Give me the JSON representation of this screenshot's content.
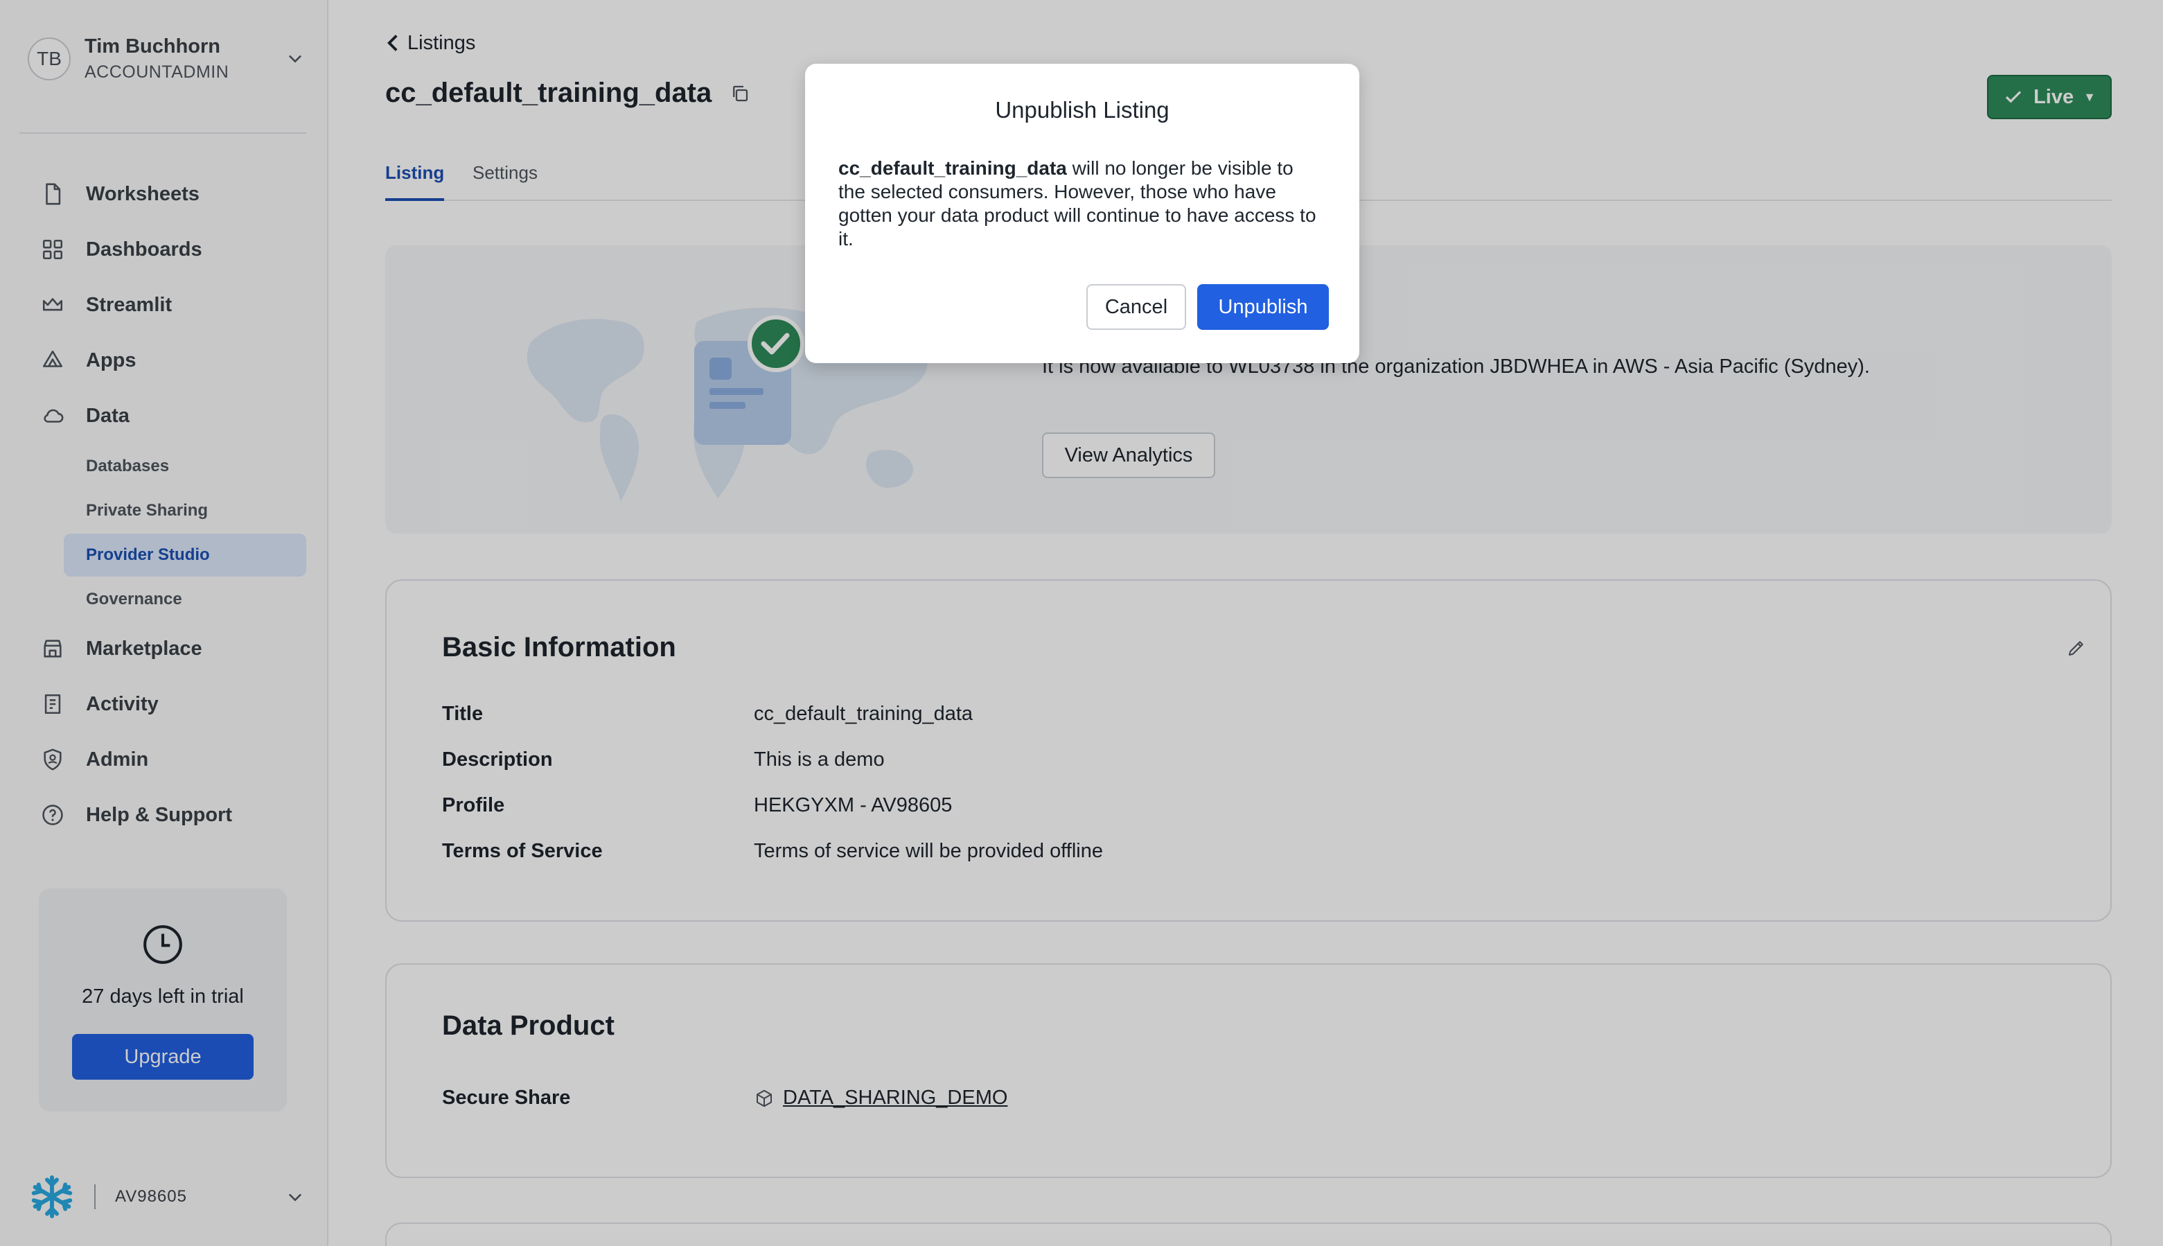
{
  "sidebar": {
    "user": {
      "initials": "TB",
      "name": "Tim Buchhorn",
      "role": "ACCOUNTADMIN"
    },
    "nav": {
      "worksheets": "Worksheets",
      "dashboards": "Dashboards",
      "streamlit": "Streamlit",
      "apps": "Apps",
      "data": "Data",
      "databases": "Databases",
      "private_sharing": "Private Sharing",
      "provider_studio": "Provider Studio",
      "governance": "Governance",
      "marketplace": "Marketplace",
      "activity": "Activity",
      "admin": "Admin",
      "help": "Help & Support"
    },
    "trial": {
      "text": "27 days left in trial",
      "upgrade_label": "Upgrade"
    },
    "account": {
      "name": "AV98605"
    }
  },
  "header": {
    "back_label": "Listings",
    "title": "cc_default_training_data",
    "status_label": "Live"
  },
  "tabs": {
    "listing": "Listing",
    "settings": "Settings"
  },
  "banner": {
    "text": "It is now available to WL03738 in the organization JBDWHEA in AWS - Asia Pacific (Sydney).",
    "analytics_label": "View Analytics"
  },
  "basic_info": {
    "heading": "Basic Information",
    "title_label": "Title",
    "title_value": "cc_default_training_data",
    "description_label": "Description",
    "description_value": "This is a demo",
    "profile_label": "Profile",
    "profile_value": "HEKGYXM - AV98605",
    "tos_label": "Terms of Service",
    "tos_value": "Terms of service will be provided offline"
  },
  "data_product": {
    "heading": "Data Product",
    "share_label": "Secure Share",
    "share_value": "DATA_SHARING_DEMO"
  },
  "modal": {
    "title": "Unpublish Listing",
    "body_strong": "cc_default_training_data",
    "body_rest": " will no longer be visible to the selected consumers. However, those who have gotten your data product will continue to have access to it.",
    "cancel_label": "Cancel",
    "confirm_label": "Unpublish"
  },
  "colors": {
    "accent": "#2160e0",
    "live": "#2e8b5a",
    "active_nav_bg": "#dbe8fb"
  }
}
